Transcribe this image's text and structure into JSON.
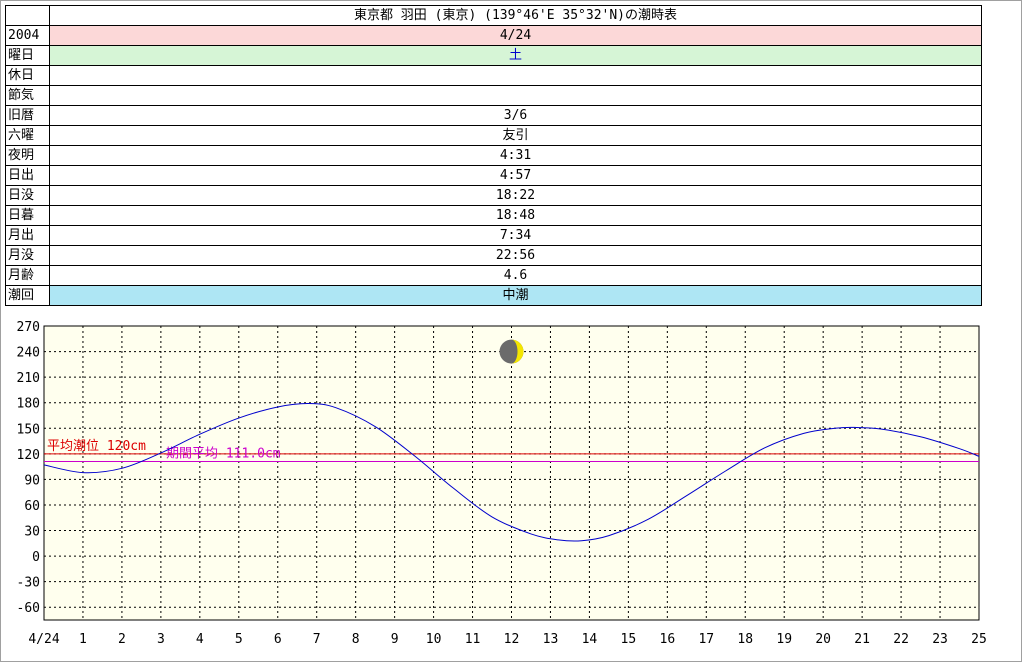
{
  "title": "東京都 羽田 (東京) (139°46'E 35°32'N)の潮時表",
  "rows": [
    {
      "label": "2004",
      "value": "4/24",
      "bg": "#fcd8d8"
    },
    {
      "label": "曜日",
      "value": "土",
      "bg": "#d6f5d6",
      "color": "#0000cc"
    },
    {
      "label": "休日",
      "value": ""
    },
    {
      "label": "節気",
      "value": ""
    },
    {
      "label": "旧暦",
      "value": "3/6"
    },
    {
      "label": "六曜",
      "value": "友引"
    },
    {
      "label": "夜明",
      "value": "4:31"
    },
    {
      "label": "日出",
      "value": "4:57"
    },
    {
      "label": "日没",
      "value": "18:22"
    },
    {
      "label": "日暮",
      "value": "18:48"
    },
    {
      "label": "月出",
      "value": "7:34"
    },
    {
      "label": "月没",
      "value": "22:56"
    },
    {
      "label": "月齢",
      "value": "4.6"
    },
    {
      "label": "潮回",
      "value": "中潮",
      "bg": "#aee6f4"
    }
  ],
  "chart_data": {
    "type": "line",
    "x_tick_labels": [
      "4/24",
      "1",
      "2",
      "3",
      "4",
      "5",
      "6",
      "7",
      "8",
      "9",
      "10",
      "11",
      "12",
      "13",
      "14",
      "15",
      "16",
      "17",
      "18",
      "19",
      "20",
      "21",
      "22",
      "23",
      "25"
    ],
    "xlim": [
      0,
      24
    ],
    "ylim": [
      -75,
      270
    ],
    "y_ticks": [
      270,
      240,
      210,
      180,
      150,
      120,
      90,
      60,
      30,
      0,
      -30,
      -60
    ],
    "grid": true,
    "background": "#ffffee",
    "reference_lines": [
      {
        "name": "平均潮位 120cm",
        "value": 120,
        "color": "#dd0000"
      },
      {
        "name": "期間平均 111.0cm",
        "value": 111,
        "color": "#cc00cc"
      }
    ],
    "series": [
      {
        "color": "#0000cc",
        "x": [
          0,
          1,
          2,
          3,
          4,
          5,
          6,
          6.8,
          7.5,
          8.5,
          9.5,
          10.5,
          11.5,
          12.5,
          13.2,
          13.8,
          14.5,
          15.5,
          16.5,
          17.5,
          18.5,
          19.5,
          20.3,
          20.8,
          21.5,
          22.5,
          23.5,
          24
        ],
        "y": [
          107,
          98,
          103,
          121,
          143,
          162,
          175,
          179,
          174,
          152,
          118,
          80,
          46,
          26,
          19,
          18,
          24,
          43,
          71,
          100,
          127,
          144,
          150,
          151,
          149,
          140,
          126,
          117
        ]
      }
    ],
    "annotation": {
      "type": "moon-phase",
      "age": 4.6,
      "x": 12,
      "y": 240
    }
  }
}
